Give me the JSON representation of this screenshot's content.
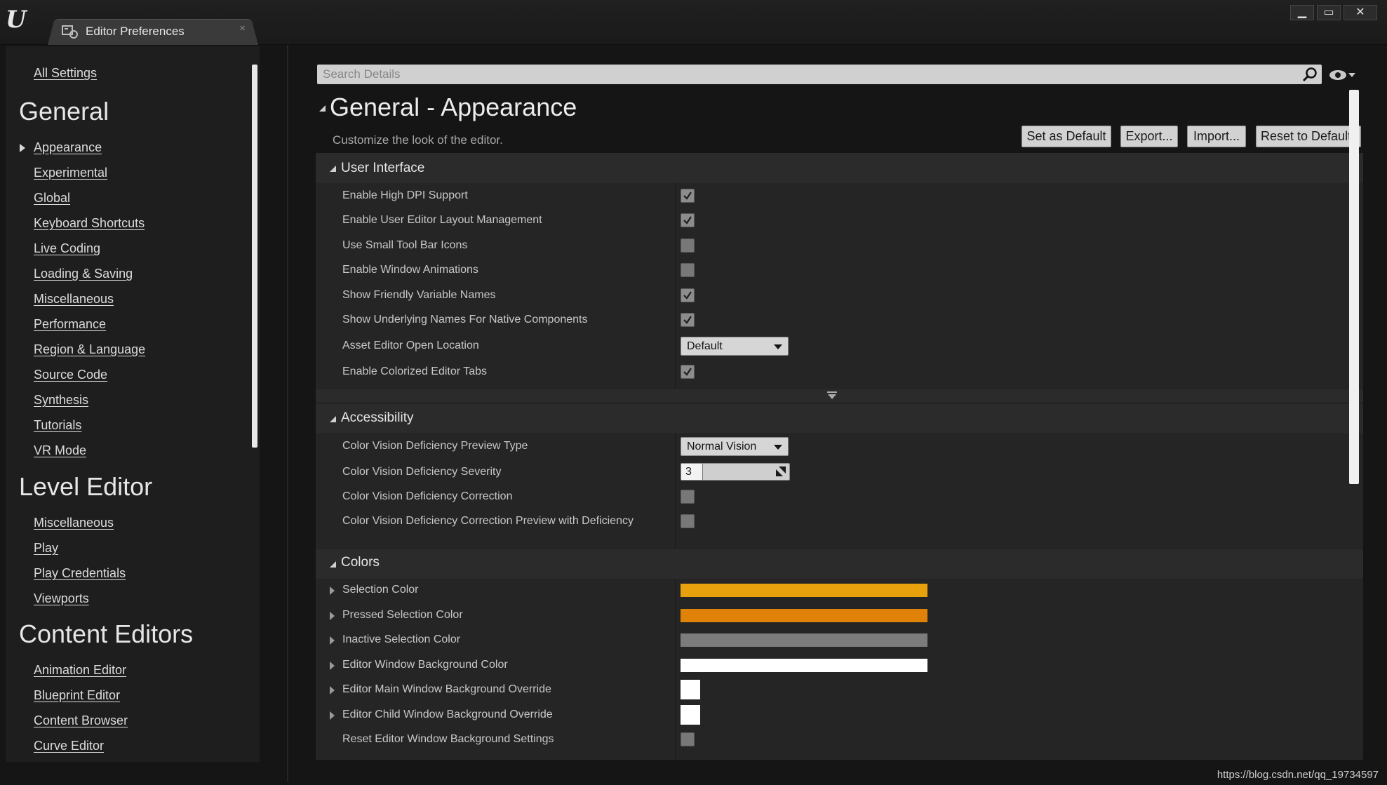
{
  "window": {
    "tab_label": "Editor Preferences",
    "tab_close": "×",
    "controls": {
      "minimize": "▁",
      "maximize": "▭",
      "close": "✕"
    }
  },
  "sidebar": {
    "all_settings": "All Settings",
    "groups": [
      {
        "heading": "General",
        "items": [
          "Appearance",
          "Experimental",
          "Global",
          "Keyboard Shortcuts",
          "Live Coding",
          "Loading & Saving",
          "Miscellaneous",
          "Performance",
          "Region & Language",
          "Source Code",
          "Synthesis",
          "Tutorials",
          "VR Mode"
        ]
      },
      {
        "heading": "Level Editor",
        "items": [
          "Miscellaneous",
          "Play",
          "Play Credentials",
          "Viewports"
        ]
      },
      {
        "heading": "Content Editors",
        "items": [
          "Animation Editor",
          "Blueprint Editor",
          "Content Browser",
          "Curve Editor"
        ]
      }
    ],
    "selected_item": "Appearance"
  },
  "search": {
    "placeholder": "Search Details"
  },
  "details": {
    "title": "General - Appearance",
    "description": "Customize the look of the editor.",
    "buttons": {
      "set_default": "Set as Default",
      "export": "Export...",
      "import": "Import...",
      "reset": "Reset to Defaults"
    }
  },
  "categories": {
    "user_interface": {
      "label": "User Interface",
      "rows": {
        "high_dpi": {
          "label": "Enable High DPI Support",
          "checked": true
        },
        "layout_mgmt": {
          "label": "Enable User Editor Layout Management",
          "checked": true
        },
        "small_icons": {
          "label": "Use Small Tool Bar Icons",
          "checked": false
        },
        "window_anim": {
          "label": "Enable Window Animations",
          "checked": false
        },
        "friendly_names": {
          "label": "Show Friendly Variable Names",
          "checked": true
        },
        "underlying_names": {
          "label": "Show Underlying Names For Native Components",
          "checked": true
        },
        "asset_open_loc": {
          "label": "Asset Editor Open Location",
          "value": "Default"
        },
        "colorized_tabs": {
          "label": "Enable Colorized Editor Tabs",
          "checked": true
        }
      }
    },
    "accessibility": {
      "label": "Accessibility",
      "rows": {
        "cvd_type": {
          "label": "Color Vision Deficiency Preview Type",
          "value": "Normal Vision"
        },
        "cvd_severity": {
          "label": "Color Vision Deficiency Severity",
          "value": "3",
          "level": 0.2
        },
        "cvd_correction": {
          "label": "Color Vision Deficiency Correction",
          "checked": false
        },
        "cvd_correction_preview": {
          "label": "Color Vision Deficiency Correction Preview with Deficiency",
          "checked": false
        }
      }
    },
    "colors": {
      "label": "Colors",
      "rows": {
        "selection": {
          "label": "Selection Color",
          "color": "#e6a10c"
        },
        "pressed_selection": {
          "label": "Pressed Selection Color",
          "color": "#e08208"
        },
        "inactive_selection": {
          "label": "Inactive Selection Color",
          "color": "#7c7c7c"
        },
        "window_bg": {
          "label": "Editor Window Background Color",
          "color": "#ffffff"
        },
        "main_window_bg": {
          "label": "Editor Main Window Background Override",
          "color": "#ffffff"
        },
        "child_window_bg": {
          "label": "Editor Child Window Background Override",
          "color": "#ffffff"
        },
        "reset_bg": {
          "label": "Reset Editor Window Background Settings",
          "checked": false
        }
      }
    }
  },
  "footer": {
    "url": "https://blog.csdn.net/qq_19734597"
  }
}
